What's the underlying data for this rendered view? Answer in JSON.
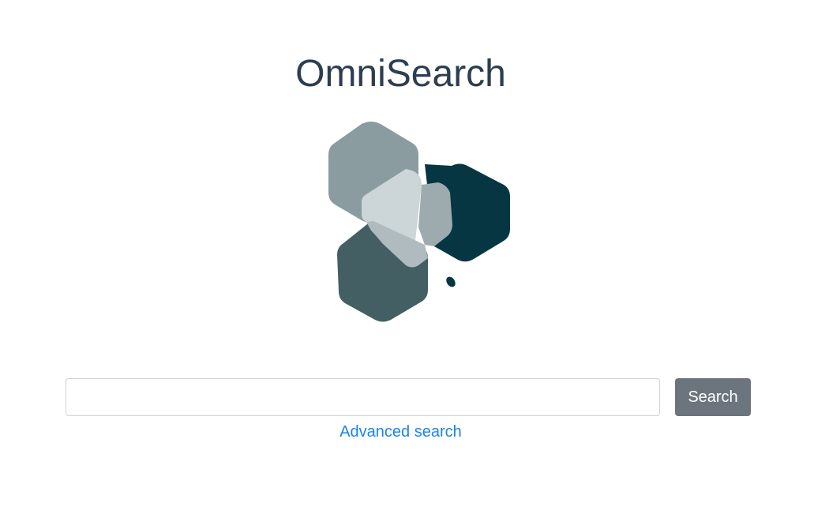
{
  "header": {
    "title": "OmniSearch"
  },
  "logo": {
    "icon": "omnisearch-hexagon-logo",
    "colors": {
      "light_gray": "#8a9ca0",
      "pale": "#ccd5d8",
      "mid_gray": "#9eabae",
      "dark_teal": "#063642",
      "slate": "#435f63",
      "silver": "#afbbbe"
    }
  },
  "search": {
    "query": "",
    "placeholder": "",
    "button_label": "Search",
    "advanced_link": "Advanced search"
  },
  "colors": {
    "title": "#2c3e50",
    "button": "#6c757d",
    "link": "#1b85e6"
  }
}
